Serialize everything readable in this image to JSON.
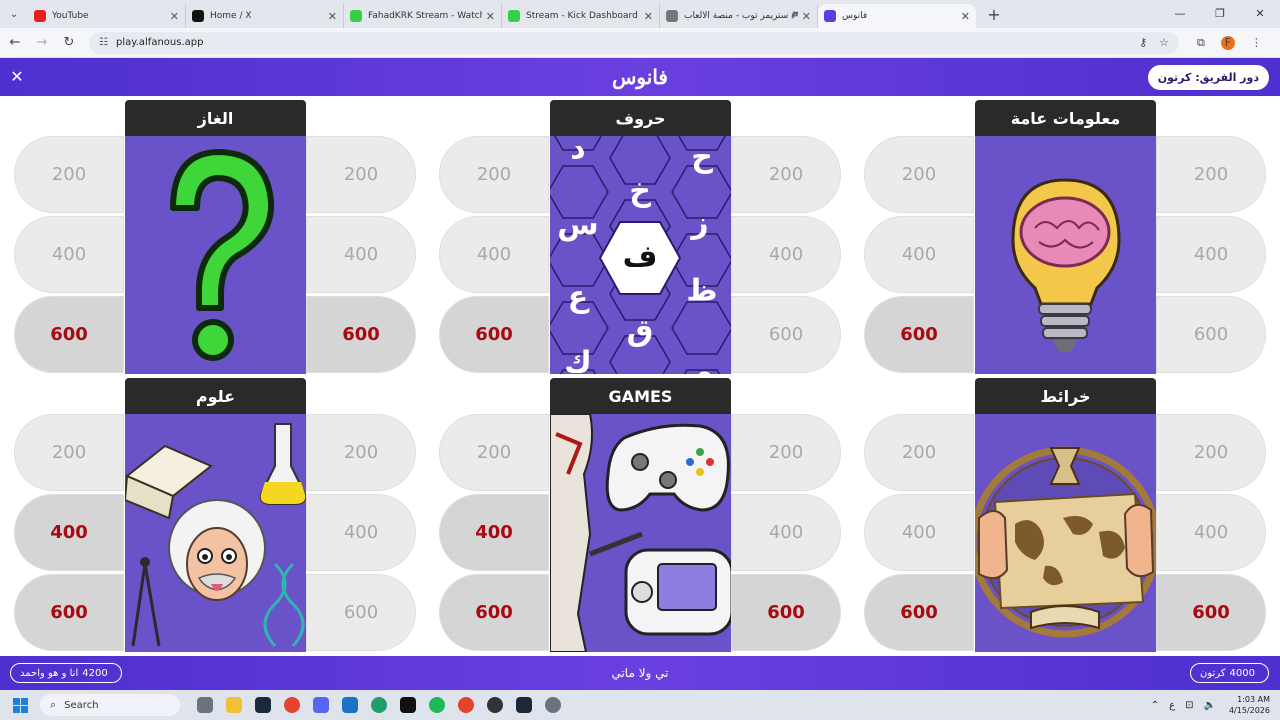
{
  "browser": {
    "tabs": [
      {
        "title": "YouTube",
        "color": "#e52020",
        "active": false
      },
      {
        "title": "Home / X",
        "color": "#111111",
        "active": false
      },
      {
        "title": "FahadKRK Stream - Watch Live",
        "color": "#35d04a",
        "active": false
      },
      {
        "title": "Stream - Kick Dashboard",
        "color": "#35d04a",
        "active": false
      },
      {
        "title": "ستريمر توب - منصة الألعاب 🎮",
        "color": "#777777",
        "active": false
      },
      {
        "title": "فانوس",
        "color": "#5a3ee0",
        "active": true
      }
    ],
    "url": "play.alfanous.app",
    "avatar_letter": "F"
  },
  "game": {
    "logo": "فانوس",
    "turn_label": "دور الفريق: كرتون",
    "close_symbol": "✕"
  },
  "categories": [
    {
      "title": "الغاز",
      "image": "question-mark",
      "left": [
        {
          "value": "200",
          "available": false
        },
        {
          "value": "400",
          "available": false
        },
        {
          "value": "600",
          "available": true
        }
      ],
      "right": [
        {
          "value": "200",
          "available": false
        },
        {
          "value": "400",
          "available": false
        },
        {
          "value": "600",
          "available": true
        }
      ]
    },
    {
      "title": "حروف",
      "image": "letters-hex",
      "left": [
        {
          "value": "200",
          "available": false
        },
        {
          "value": "400",
          "available": false
        },
        {
          "value": "600",
          "available": true
        }
      ],
      "right": [
        {
          "value": "200",
          "available": false
        },
        {
          "value": "400",
          "available": false
        },
        {
          "value": "600",
          "available": false
        }
      ],
      "letters": [
        "ح",
        "د",
        "خ",
        "ز",
        "س",
        "ف",
        "ظ",
        "ع",
        "ق",
        "ك",
        "م"
      ]
    },
    {
      "title": "معلومات عامة",
      "image": "brain-bulb",
      "left": [
        {
          "value": "200",
          "available": false
        },
        {
          "value": "400",
          "available": false
        },
        {
          "value": "600",
          "available": true
        }
      ],
      "right": [
        {
          "value": "200",
          "available": false
        },
        {
          "value": "400",
          "available": false
        },
        {
          "value": "600",
          "available": false
        }
      ]
    },
    {
      "title": "علوم",
      "image": "science",
      "left": [
        {
          "value": "200",
          "available": false
        },
        {
          "value": "400",
          "available": true
        },
        {
          "value": "600",
          "available": true
        }
      ],
      "right": [
        {
          "value": "200",
          "available": false
        },
        {
          "value": "400",
          "available": false
        },
        {
          "value": "600",
          "available": false
        }
      ]
    },
    {
      "title": "GAMES",
      "image": "games",
      "left": [
        {
          "value": "200",
          "available": false
        },
        {
          "value": "400",
          "available": true
        },
        {
          "value": "600",
          "available": true
        }
      ],
      "right": [
        {
          "value": "200",
          "available": false
        },
        {
          "value": "400",
          "available": false
        },
        {
          "value": "600",
          "available": true
        }
      ]
    },
    {
      "title": "خرائط",
      "image": "map",
      "left": [
        {
          "value": "200",
          "available": false
        },
        {
          "value": "400",
          "available": false
        },
        {
          "value": "600",
          "available": true
        }
      ],
      "right": [
        {
          "value": "200",
          "available": false
        },
        {
          "value": "400",
          "available": false
        },
        {
          "value": "600",
          "available": true
        }
      ]
    }
  ],
  "footer": {
    "left_team": {
      "name": "انا و هو واحمد",
      "score": "4200"
    },
    "title": "تي ولا ماتي",
    "right_team": {
      "name": "كرتون",
      "score": "4000"
    }
  },
  "taskbar": {
    "search_label": "Search",
    "lang": "ع",
    "time": "1:03 AM",
    "date": "4/15/2026"
  },
  "colors": {
    "accent": "#5a3ee0",
    "available_text": "#a80a12",
    "used_text": "#a9a9a9"
  }
}
